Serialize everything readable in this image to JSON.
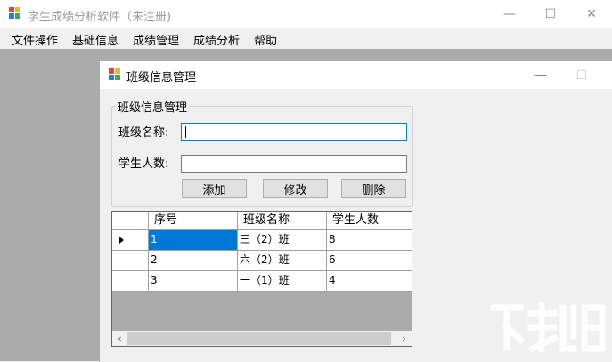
{
  "main_window": {
    "title": "学生成绩分析软件（未注册)",
    "controls": {
      "minimize": "—",
      "maximize": "☐",
      "close": "✕"
    }
  },
  "menu": {
    "items": [
      {
        "label": "文件操作"
      },
      {
        "label": "基础信息"
      },
      {
        "label": "成绩管理"
      },
      {
        "label": "成绩分析"
      },
      {
        "label": "帮助"
      }
    ]
  },
  "child_window": {
    "title": "班级信息管理",
    "controls": {
      "minimize": "—",
      "maximize": "☐"
    },
    "groupbox": {
      "title": "班级信息管理",
      "class_name_label": "班级名称:",
      "class_name_value": "",
      "student_count_label": "学生人数:",
      "student_count_value": "",
      "buttons": {
        "add": "添加",
        "edit": "修改",
        "delete": "删除"
      }
    },
    "grid": {
      "columns": [
        "序号",
        "班级名称",
        "学生人数"
      ],
      "rows": [
        {
          "id": "1",
          "name": "三（2）班",
          "count": "8"
        },
        {
          "id": "2",
          "name": "六（2）班",
          "count": "6"
        },
        {
          "id": "3",
          "name": "一（1）班",
          "count": "4"
        }
      ],
      "selected_row": 0,
      "scroll_left_icon": "‹",
      "scroll_right_icon": "›"
    }
  },
  "icons": {
    "app_icon": "app-icon",
    "row_pointer": "row-pointer-icon"
  },
  "colors": {
    "selection": "#0078d7",
    "mdi_background": "#ababab",
    "title_gray": "#999999"
  }
}
